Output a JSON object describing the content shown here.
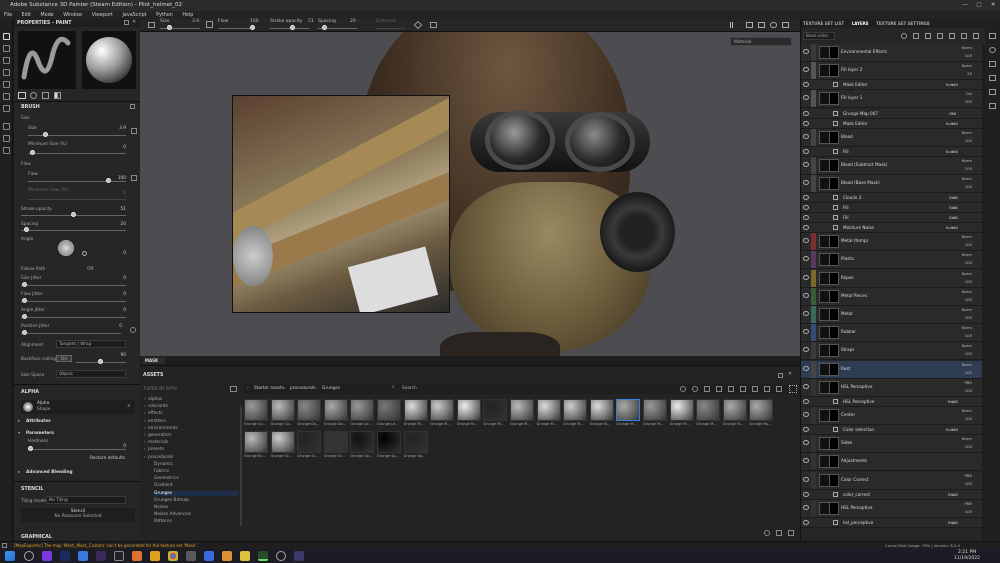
{
  "window": {
    "title": "Adobe Substance 3D Painter (Steam Edition) - Pilot_helmet_02",
    "min": "—",
    "max": "□",
    "close": "✕"
  },
  "menu": [
    "File",
    "Edit",
    "Mode",
    "Window",
    "Viewport",
    "JavaScript",
    "Python",
    "Help"
  ],
  "toolbar": {
    "size_label": "Size",
    "size_val": "3.9",
    "flow_label": "Flow",
    "flow_val": "100",
    "stroke_label": "Stroke opacity",
    "stroke_val": "51",
    "spacing_label": "Spacing",
    "spacing_val": "20",
    "distance_label": "Distance",
    "distance_val": "",
    "material_dropdown": "Material"
  },
  "props": {
    "title": "PROPERTIES - PAINT",
    "brush": "BRUSH",
    "size": "Size",
    "size_val": "3.9",
    "min_size": "Minimum Size (%)",
    "min_size_val": "0",
    "flow": "Flow",
    "flow_val": "100",
    "min_flow": "Minimum Flow (%)",
    "min_flow_val": "0",
    "stroke": "Stroke opacity",
    "stroke_val": "51",
    "spacing": "Spacing",
    "spacing_val": "20",
    "angle": "Angle",
    "angle_val": "0",
    "follow": "Follow Path",
    "follow_val": "Off",
    "size_jitter": "Size Jitter",
    "size_jitter_val": "0",
    "flow_jitter": "Flow Jitter",
    "flow_jitter_val": "0",
    "angle_jitter": "Angle Jitter",
    "angle_jitter_val": "0",
    "pos_jitter": "Position Jitter",
    "pos_jitter_val": "0",
    "alignment": "Alignment",
    "alignment_val": "Tangent | Wrap",
    "backface": "Backface culling",
    "backface_val": "On",
    "backface_num": "90",
    "size_space": "Size Space",
    "size_space_val": "Object",
    "alpha": "ALPHA",
    "alpha_name": "Alpha",
    "alpha_sub": "Shape",
    "attributes": "Attributes",
    "parameters": "Parameters",
    "hardness": "Hardness",
    "hardness_val": "0",
    "restore": "Restore defaults",
    "adv_blend": "Advanced Blending",
    "stencil": "STENCIL",
    "tiling": "Tiling mode",
    "tiling_val": "No Tiling",
    "stencil_btn": "Stencil",
    "stencil_sub": "No Resource Selected",
    "graphical": "GRAPHICAL"
  },
  "mask_tab": "MASK",
  "assets": {
    "title": "ASSETS",
    "filter": "FILTER BY PATH",
    "breadcrumb": [
      "Starter assets",
      "procedurals",
      "Grunges"
    ],
    "search": "Search",
    "tree": [
      "alphas",
      "colorants",
      "effects",
      "emitters",
      "environments",
      "generators",
      "materials",
      "presets",
      "procedurals",
      "Dynamic",
      "Fabrics",
      "Geometrics",
      "Gradient",
      "Grunges",
      "Grunges Bitmap",
      "Noises",
      "Noises Advanced",
      "Patterns"
    ],
    "thumb_labels": [
      "Grunge Co...",
      "Grunge Co...",
      "Grunge Da...",
      "Grunge Da...",
      "Grunge Le...",
      "Grunge Le...",
      "Grunge M...",
      "Grunge M...",
      "Grunge M...",
      "Grunge M...",
      "Grunge M...",
      "Grunge M...",
      "Grunge M...",
      "Grunge M...",
      "Grunge M...",
      "Grunge M...",
      "Grunge M...",
      "Grunge M...",
      "Grunge M...",
      "Grunge Ro...",
      "Grunge Ru...",
      "Grunge Sc...",
      "Grunge Sc...",
      "Grunge Sc...",
      "Grunge Sp...",
      "Grunge Sp...",
      "Grunge Sp..."
    ]
  },
  "right": {
    "tabs": [
      "TEXTURE SET LIST",
      "LAYERS",
      "TEXTURE SET SETTINGS"
    ],
    "basecolor": "Base color",
    "layers": [
      {
        "name": "Environmental Effects",
        "blend": "Norm",
        "op": "100",
        "sub": false,
        "color": "#3a3a3a"
      },
      {
        "name": "Fill layer 2",
        "blend": "Norm",
        "op": "25",
        "sub": false,
        "color": "#555"
      },
      {
        "name": "Mask Editor",
        "blend": "Norm",
        "op": "100",
        "sub": true
      },
      {
        "name": "Fill layer 1",
        "blend": "Ovl",
        "op": "100",
        "sub": false,
        "color": "#555"
      },
      {
        "name": "Grunge Map 007",
        "blend": "Mul",
        "op": "75",
        "sub": true
      },
      {
        "name": "Mask Editor",
        "blend": "Norm",
        "op": "100",
        "sub": true
      },
      {
        "name": "Blood",
        "blend": "Norm",
        "op": "100",
        "sub": false,
        "color": "#444"
      },
      {
        "name": "Fill",
        "blend": "Norm",
        "op": "100",
        "sub": true
      },
      {
        "name": "Blood (Subtract Mask)",
        "blend": "Norm",
        "op": "100",
        "sub": false,
        "color": "#444"
      },
      {
        "name": "Blood (Base Mask)",
        "blend": "Norm",
        "op": "100",
        "sub": false,
        "color": "#444"
      },
      {
        "name": "Clouds 3",
        "blend": "Sub",
        "op": "100",
        "sub": true
      },
      {
        "name": "Fill",
        "blend": "Sub",
        "op": "100",
        "sub": true
      },
      {
        "name": "Fill",
        "blend": "Sub",
        "op": "100",
        "sub": true
      },
      {
        "name": "Moisture Noise",
        "blend": "Norm",
        "op": "100",
        "sub": true
      },
      {
        "name": "Metal (temp)",
        "blend": "Norm",
        "op": "100",
        "sub": false,
        "color": "#7a3030"
      },
      {
        "name": "Plastic",
        "blend": "Norm",
        "op": "100",
        "sub": false,
        "color": "#5a3a5a"
      },
      {
        "name": "Ropes",
        "blend": "Norm",
        "op": "100",
        "sub": false,
        "color": "#7a6a2a"
      },
      {
        "name": "Metal Pieces",
        "blend": "Norm",
        "op": "100",
        "sub": false,
        "color": "#3a5a3a"
      },
      {
        "name": "Metal",
        "blend": "Norm",
        "op": "100",
        "sub": false,
        "color": "#3a6a5a"
      },
      {
        "name": "Rubber",
        "blend": "Norm",
        "op": "100",
        "sub": false,
        "color": "#3a4a7a"
      },
      {
        "name": "Straps",
        "blend": "Norm",
        "op": "100",
        "sub": false,
        "color": "#3a3a3a"
      },
      {
        "name": "Rust",
        "blend": "Norm",
        "op": "100",
        "sub": false,
        "color": "#444",
        "selected": true
      },
      {
        "name": "HSL Perceptive",
        "blend": "PBR",
        "op": "100",
        "sub": false,
        "color": "#333"
      },
      {
        "name": "HSL Perceptive",
        "blend": "Repl",
        "op": "100",
        "sub": true
      },
      {
        "name": "Center",
        "blend": "Norm",
        "op": "100",
        "sub": false,
        "color": "#333"
      },
      {
        "name": "Color selection",
        "blend": "Norm",
        "op": "100",
        "sub": true
      },
      {
        "name": "Sides",
        "blend": "Norm",
        "op": "100",
        "sub": false,
        "color": "#333"
      },
      {
        "name": "Adjustments",
        "blend": "",
        "op": "",
        "sub": false,
        "color": "#333"
      },
      {
        "name": "Color Correct",
        "blend": "PBR",
        "op": "100",
        "sub": false,
        "color": "#333"
      },
      {
        "name": "color_correct",
        "blend": "Repl",
        "op": "100",
        "sub": true
      },
      {
        "name": "HSL Perceptive",
        "blend": "PBR",
        "op": "100",
        "sub": false,
        "color": "#333"
      },
      {
        "name": "hsl_perceptive",
        "blend": "Repl",
        "op": "100",
        "sub": true
      }
    ]
  },
  "status": {
    "msg": "[MapExporter] The map 'Mesh_Mask_Custom' can't be generated for the texture set 'Mask'.",
    "cache": "Cache Disk Usage: 79% | Version: 8.2.0"
  },
  "clock": {
    "time": "2:21 PM",
    "date": "11/19/2022"
  },
  "colors": {
    "accent": "#3a7bd5",
    "bg": "#262626",
    "folder": "#d4a843"
  }
}
